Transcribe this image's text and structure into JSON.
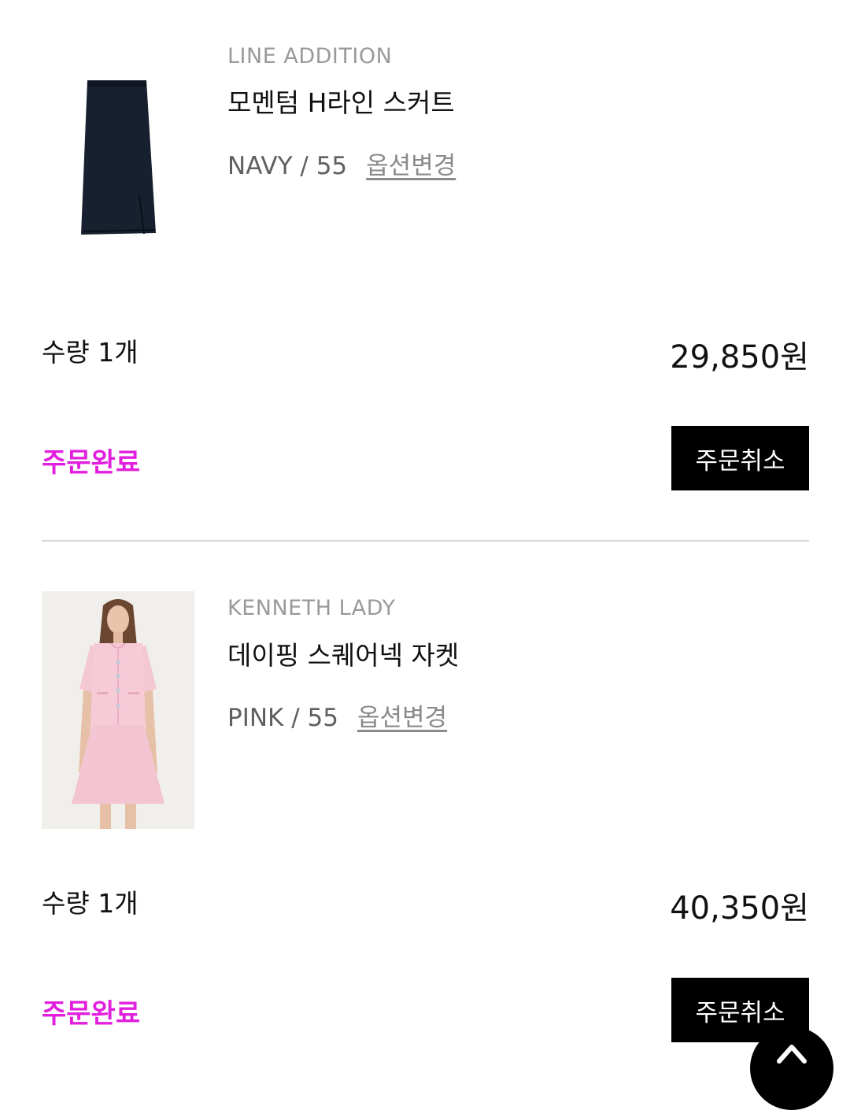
{
  "orders": [
    {
      "brand": "LINE ADDITION",
      "name": "모멘텀 H라인 스커트",
      "option": "NAVY / 55",
      "option_change_label": "옵션변경",
      "quantity": "수량 1개",
      "price": "29,850원",
      "status": "주문완료",
      "cancel_label": "주문취소",
      "thumb_color": "#1a2433"
    },
    {
      "brand": "KENNETH LADY",
      "name": "데이핑 스퀘어넥 자켓",
      "option": "PINK / 55",
      "option_change_label": "옵션변경",
      "quantity": "수량 1개",
      "price": "40,350원",
      "status": "주문완료",
      "cancel_label": "주문취소",
      "thumb_color": "#f2c4d2"
    }
  ],
  "colors": {
    "status": "#e21fde",
    "button_bg": "#000000",
    "divider": "#d8d8d8"
  },
  "icons": {
    "scroll_top": "arrow-up-icon"
  }
}
